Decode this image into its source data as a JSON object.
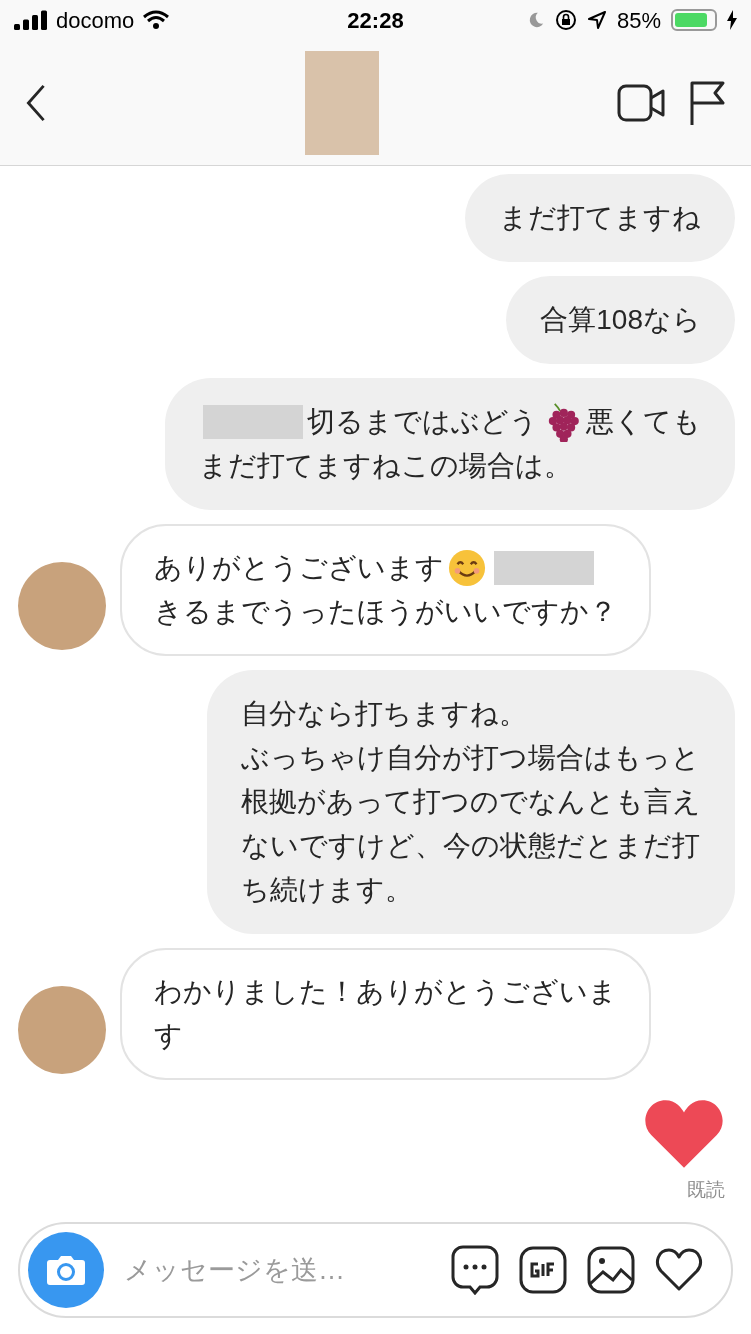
{
  "status_bar": {
    "carrier": "docomo",
    "time": "22:28",
    "battery_text": "85%",
    "battery": {
      "level": 0.85
    }
  },
  "messages": [
    {
      "outgoing": true,
      "lines": [
        [
          {
            "kind": "text",
            "text": "まだ打てますね"
          }
        ]
      ]
    },
    {
      "outgoing": true,
      "lines": [
        [
          {
            "kind": "text",
            "text": "合算108なら"
          }
        ]
      ]
    },
    {
      "outgoing": true,
      "lines": [
        [
          {
            "kind": "redacted"
          },
          {
            "kind": "text",
            "text": "切るまではぶどう"
          },
          {
            "kind": "grapes"
          },
          {
            "kind": "text",
            "text": "悪くても"
          }
        ],
        [
          {
            "kind": "text",
            "text": "まだ打てますねこの場合は。"
          }
        ]
      ]
    },
    {
      "outgoing": false,
      "lines": [
        [
          {
            "kind": "text",
            "text": "ありがとうございます"
          },
          {
            "kind": "smile"
          },
          {
            "kind": "redacted"
          }
        ],
        [
          {
            "kind": "text",
            "text": "きるまでうったほうがいいですか？"
          }
        ]
      ]
    },
    {
      "outgoing": true,
      "lines": [
        [
          {
            "kind": "text",
            "text": "自分なら打ちますね。"
          }
        ],
        [
          {
            "kind": "text",
            "text": "ぶっちゃけ自分が打つ場合はもっと"
          }
        ],
        [
          {
            "kind": "text",
            "text": "根拠があって打つのでなんとも言え"
          }
        ],
        [
          {
            "kind": "text",
            "text": "ないですけど、今の状態だとまだ打"
          }
        ],
        [
          {
            "kind": "text",
            "text": "ち続けます。"
          }
        ]
      ]
    },
    {
      "outgoing": false,
      "lines": [
        [
          {
            "kind": "text",
            "text": "わかりました！ありがとうございま"
          }
        ],
        [
          {
            "kind": "text",
            "text": "す"
          }
        ]
      ]
    }
  ],
  "last_sent": {
    "kind": "heart",
    "read_label": "既読"
  },
  "composer": {
    "placeholder": "メッセージを送…"
  }
}
